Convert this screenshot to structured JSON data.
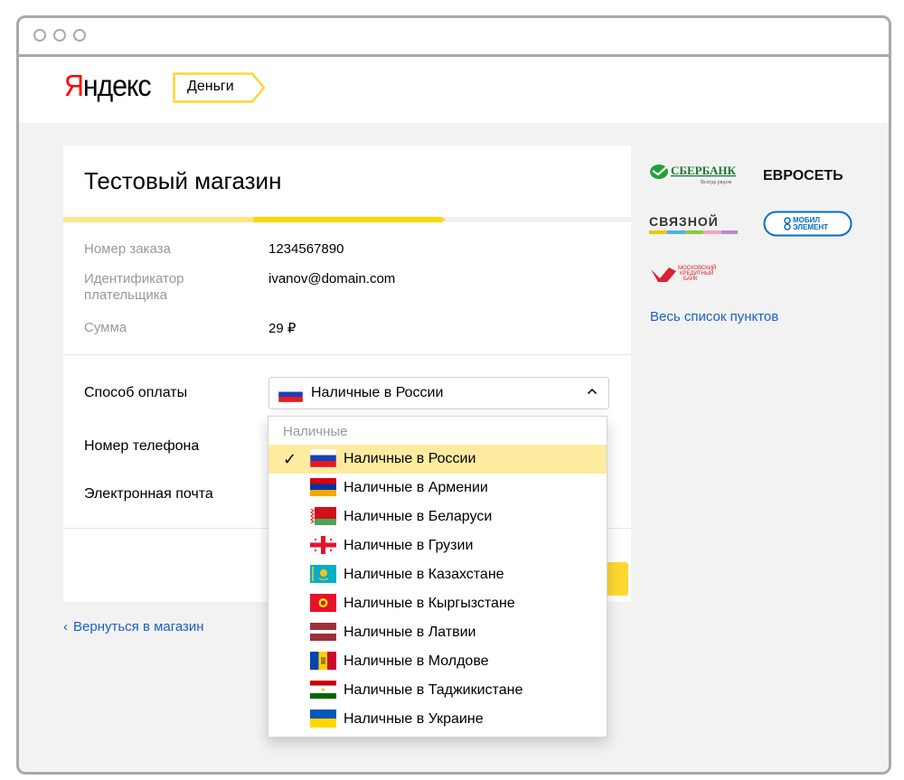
{
  "header": {
    "logo_first": "Я",
    "logo_rest": "ндекс",
    "service_tag": "Деньги"
  },
  "shop": {
    "title": "Тестовый магазин"
  },
  "order": {
    "number_label": "Номер заказа",
    "number_value": "1234567890",
    "payer_label": "Идентификатор плательщика",
    "payer_value": "ivanov@domain.com",
    "sum_label": "Сумма",
    "sum_value": "29 ₽"
  },
  "form": {
    "payment_method_label": "Способ оплаты",
    "payment_method_value": "Наличные в России",
    "phone_label": "Номер телефона",
    "email_label": "Электронная почта"
  },
  "dropdown": {
    "group_label": "Наличные",
    "check_mark": "✓",
    "items": [
      {
        "label": "Наличные в России",
        "flag": "russia-flag-icon",
        "selected": true
      },
      {
        "label": "Наличные в Армении",
        "flag": "armenia-flag-icon",
        "selected": false
      },
      {
        "label": "Наличные в Беларуси",
        "flag": "belarus-flag-icon",
        "selected": false
      },
      {
        "label": "Наличные в Грузии",
        "flag": "georgia-flag-icon",
        "selected": false
      },
      {
        "label": "Наличные в Казахстане",
        "flag": "kazakhstan-flag-icon",
        "selected": false
      },
      {
        "label": "Наличные в Кыргызстане",
        "flag": "kyrgyzstan-flag-icon",
        "selected": false
      },
      {
        "label": "Наличные в Латвии",
        "flag": "latvia-flag-icon",
        "selected": false
      },
      {
        "label": "Наличные в Молдове",
        "flag": "moldova-flag-icon",
        "selected": false
      },
      {
        "label": "Наличные в Таджикистане",
        "flag": "tajikistan-flag-icon",
        "selected": false
      },
      {
        "label": "Наличные в Украине",
        "flag": "ukraine-flag-icon",
        "selected": false
      }
    ]
  },
  "navigation": {
    "back_link": "Вернуться в магазин",
    "back_arrow": "‹"
  },
  "sidebar": {
    "partners": [
      {
        "name": "СБЕРБАНК",
        "tagline": "Всегда рядом"
      },
      {
        "name": "ЕВРОСЕТЬ"
      },
      {
        "name": "СВЯЗНОЙ"
      },
      {
        "name_line1": "МОБИЛ",
        "name_line2": "ЭЛЕМЕНТ"
      },
      {
        "name_line1": "МОСКОВСКИЙ",
        "name_line2": "КРЕДИТНЫЙ",
        "name_line3": "БАНК"
      }
    ],
    "all_points_link": "Весь список пунктов"
  },
  "colors": {
    "accent_yellow": "#ffd700",
    "link_blue": "#1b60c8",
    "selected_row": "#ffeba0",
    "logo_red": "#ff0000"
  }
}
